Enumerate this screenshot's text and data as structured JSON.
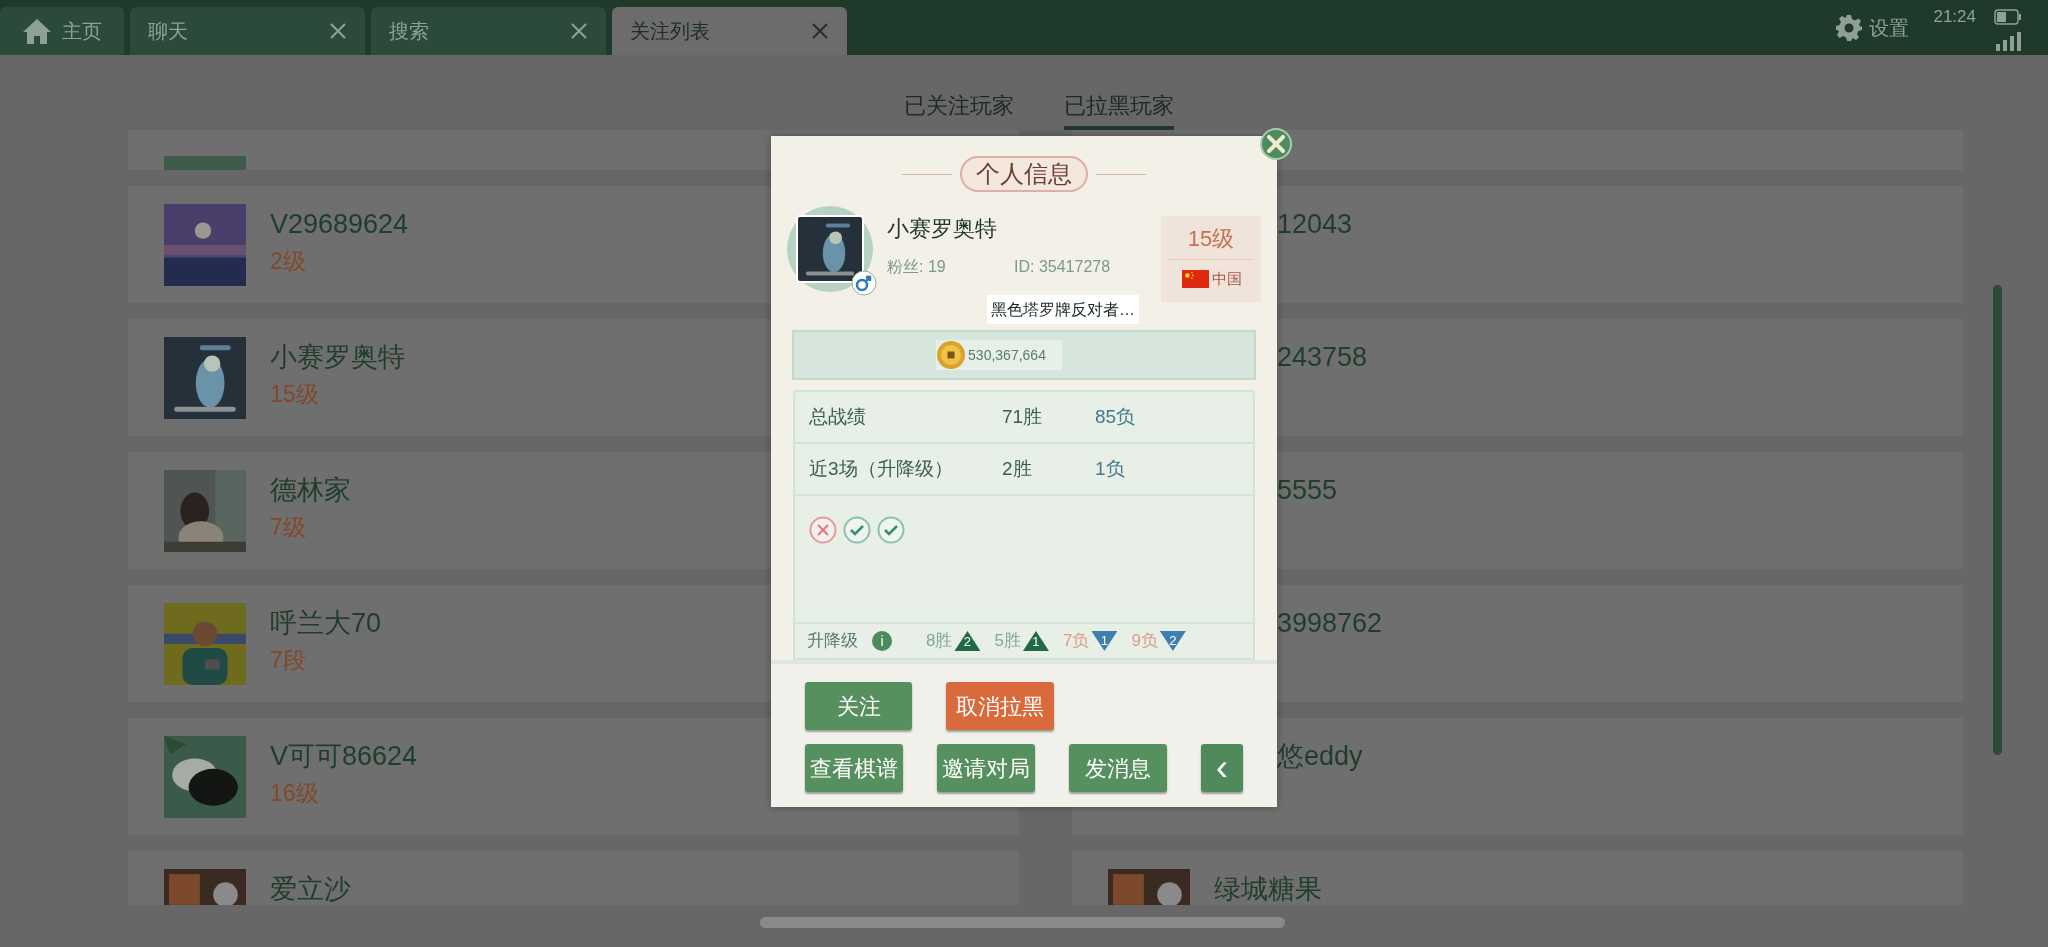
{
  "top_bar": {
    "tabs": [
      {
        "label": "主页",
        "kind": "home",
        "selected": false
      },
      {
        "label": "聊天",
        "kind": "closable",
        "selected": false
      },
      {
        "label": "搜索",
        "kind": "closable",
        "selected": false
      },
      {
        "label": "关注列表",
        "kind": "closable",
        "selected": true
      }
    ],
    "settings": "设置",
    "time": "21:24"
  },
  "sub_tabs": [
    {
      "label": "已关注玩家",
      "selected": false
    },
    {
      "label": "已拉黑玩家",
      "selected": true
    }
  ],
  "players_left": [
    {
      "name": "V29689624",
      "level": "2级"
    },
    {
      "name": "小赛罗奥特",
      "level": "15级"
    },
    {
      "name": "德林家",
      "level": "7级"
    },
    {
      "name": "呼兰大70",
      "level": "7段"
    },
    {
      "name": "V可可86624",
      "level": "16级"
    },
    {
      "name": "爱立沙"
    }
  ],
  "players_right": [
    {
      "name": "12043",
      "kind": "covered"
    },
    {
      "name": "243758",
      "kind": "covered"
    },
    {
      "name": "5555",
      "kind": "covered"
    },
    {
      "name": "3998762",
      "kind": "covered"
    },
    {
      "name": "悠eddy",
      "kind": "covered"
    },
    {
      "name": "绿城糖果",
      "kind": "plain"
    }
  ],
  "profile": {
    "title": "个人信息",
    "name": "小赛罗奥特",
    "fans": "粉丝: 19",
    "id": "ID: 35417278",
    "level": "15级",
    "country": "中国",
    "signature": "黑色塔罗牌反对者…",
    "coins": "530,367,664",
    "stats": [
      {
        "label": "总战绩",
        "wins": "71胜",
        "losses": "85负"
      },
      {
        "label": "近3场（升降级）",
        "wins": "2胜",
        "losses": "1负"
      }
    ],
    "recent": [
      {
        "kind": "loss"
      },
      {
        "kind": "win"
      },
      {
        "kind": "win"
      }
    ],
    "promotion": {
      "label": "升降级",
      "info": "i",
      "steps": [
        {
          "label": "8胜",
          "count": "2",
          "kind": "up"
        },
        {
          "label": "5胜",
          "count": "1",
          "kind": "up"
        },
        {
          "label": "7负",
          "count": "1",
          "kind": "down"
        },
        {
          "label": "9负",
          "count": "2",
          "kind": "down"
        }
      ]
    },
    "buttons": [
      {
        "label": "关注",
        "kind": "green"
      },
      {
        "label": "取消拉黑",
        "kind": "orange"
      }
    ],
    "buttons_row2": [
      {
        "label": "查看棋谱",
        "kind": "green"
      },
      {
        "label": "邀请对局",
        "kind": "green"
      },
      {
        "label": "发消息",
        "kind": "green"
      },
      {
        "label": "‹",
        "kind": "arrow"
      }
    ]
  }
}
